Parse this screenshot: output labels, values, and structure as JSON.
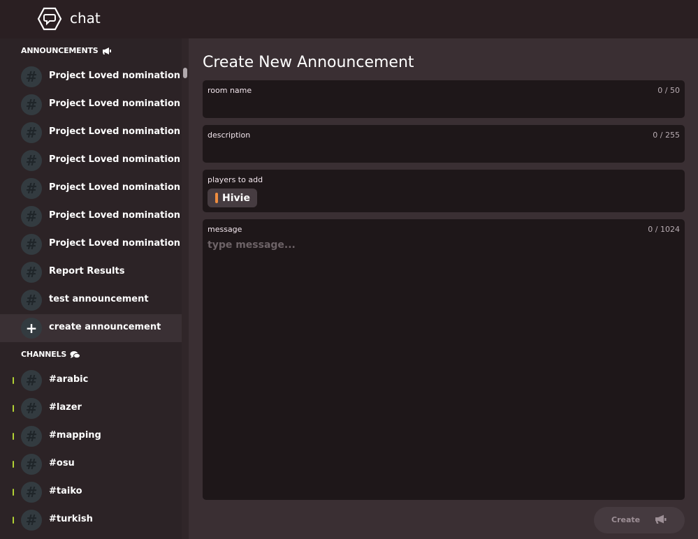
{
  "header": {
    "title": "chat",
    "logo_icon": "chat-bubble-hexagon-icon"
  },
  "sidebar": {
    "announcements_label": "ANNOUNCEMENTS",
    "announcements_icon": "megaphone-icon",
    "announcements": [
      {
        "label": "Project Loved nomination"
      },
      {
        "label": "Project Loved nomination"
      },
      {
        "label": "Project Loved nomination"
      },
      {
        "label": "Project Loved nomination"
      },
      {
        "label": "Project Loved nomination"
      },
      {
        "label": "Project Loved nomination"
      },
      {
        "label": "Project Loved nomination"
      },
      {
        "label": "Report Results"
      },
      {
        "label": "test announcement"
      }
    ],
    "create_announcement_label": "create announcement",
    "channels_label": "CHANNELS",
    "channels_icon": "chat-bubbles-icon",
    "channels": [
      {
        "label": "#arabic",
        "unread": true
      },
      {
        "label": "#lazer",
        "unread": true
      },
      {
        "label": "#mapping",
        "unread": true
      },
      {
        "label": "#osu",
        "unread": true
      },
      {
        "label": "#taiko",
        "unread": true
      },
      {
        "label": "#turkish",
        "unread": true
      }
    ]
  },
  "main": {
    "title": "Create New Announcement",
    "fields": {
      "room_name": {
        "label": "room name",
        "value": "",
        "counter": "0 / 50"
      },
      "description": {
        "label": "description",
        "value": "",
        "counter": "0 / 255"
      },
      "players": {
        "label": "players to add",
        "chips": [
          {
            "name": "Hivie",
            "color": "#ee8d3f"
          }
        ]
      },
      "message": {
        "label": "message",
        "placeholder": "type message...",
        "value": "",
        "counter": "0 / 1024"
      }
    },
    "create_button_label": "Create"
  },
  "colors": {
    "header_bg": "#2a1f22",
    "sidebar_bg": "#2c2326",
    "main_bg": "#3a2f33",
    "field_bg": "#1e1719",
    "unread_indicator": "#b2d235",
    "user_chip_accent": "#ee8d3f"
  }
}
